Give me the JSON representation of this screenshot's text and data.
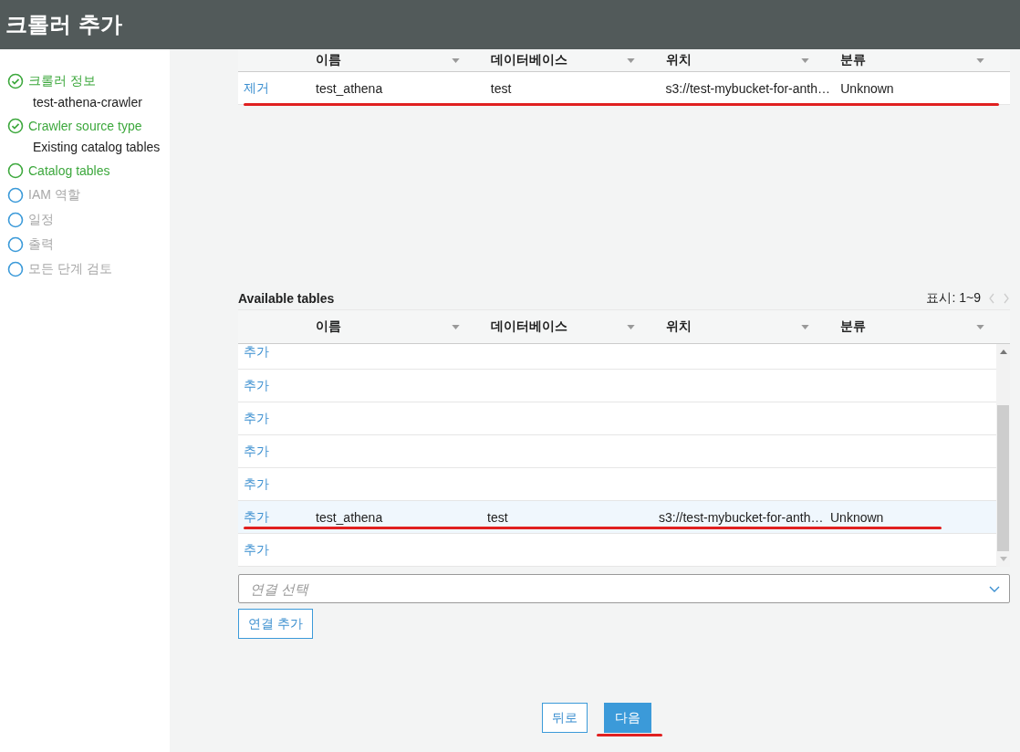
{
  "header": {
    "title": "크롤러 추가"
  },
  "steps": [
    {
      "label": "크롤러 정보",
      "completed": true,
      "enabled": true,
      "detail": "test-athena-crawler"
    },
    {
      "label": "Crawler source type",
      "completed": true,
      "enabled": true,
      "detail": "Existing catalog tables"
    },
    {
      "label": "Catalog tables",
      "completed": false,
      "enabled": true
    },
    {
      "label": "IAM 역할",
      "completed": false,
      "enabled": false
    },
    {
      "label": "일정",
      "completed": false,
      "enabled": false
    },
    {
      "label": "출력",
      "completed": false,
      "enabled": false
    },
    {
      "label": "모든 단계 검토",
      "completed": false,
      "enabled": false
    }
  ],
  "selected_tables": {
    "columns": [
      "이름",
      "데이터베이스",
      "위치",
      "분류"
    ],
    "rows": [
      {
        "action": "제거",
        "cells": [
          "test_athena",
          "test",
          "s3://test-mybucket-for-anth…",
          "Unknown"
        ],
        "underlined": true,
        "highlighted": false
      }
    ]
  },
  "available_tables": {
    "title": "Available tables",
    "paging": "표시: 1~9",
    "columns": [
      "이름",
      "데이터베이스",
      "위치",
      "분류"
    ],
    "rows": [
      {
        "action": "추가",
        "cells": [],
        "underlined": false,
        "highlighted": false
      },
      {
        "action": "추가",
        "cells": [],
        "underlined": false,
        "highlighted": false
      },
      {
        "action": "추가",
        "cells": [],
        "underlined": false,
        "highlighted": false
      },
      {
        "action": "추가",
        "cells": [],
        "underlined": false,
        "highlighted": false
      },
      {
        "action": "추가",
        "cells": [],
        "underlined": false,
        "highlighted": false
      },
      {
        "action": "추가",
        "cells": [
          "test_athena",
          "test",
          "s3://test-mybucket-for-anth…",
          "Unknown"
        ],
        "underlined": true,
        "highlighted": true
      },
      {
        "action": "추가",
        "cells": [],
        "underlined": false,
        "highlighted": false
      }
    ]
  },
  "connection": {
    "placeholder": "연결 선택",
    "add_button": "연결 추가"
  },
  "footer": {
    "back": "뒤로",
    "next": "다음",
    "next_underlined": true
  }
}
